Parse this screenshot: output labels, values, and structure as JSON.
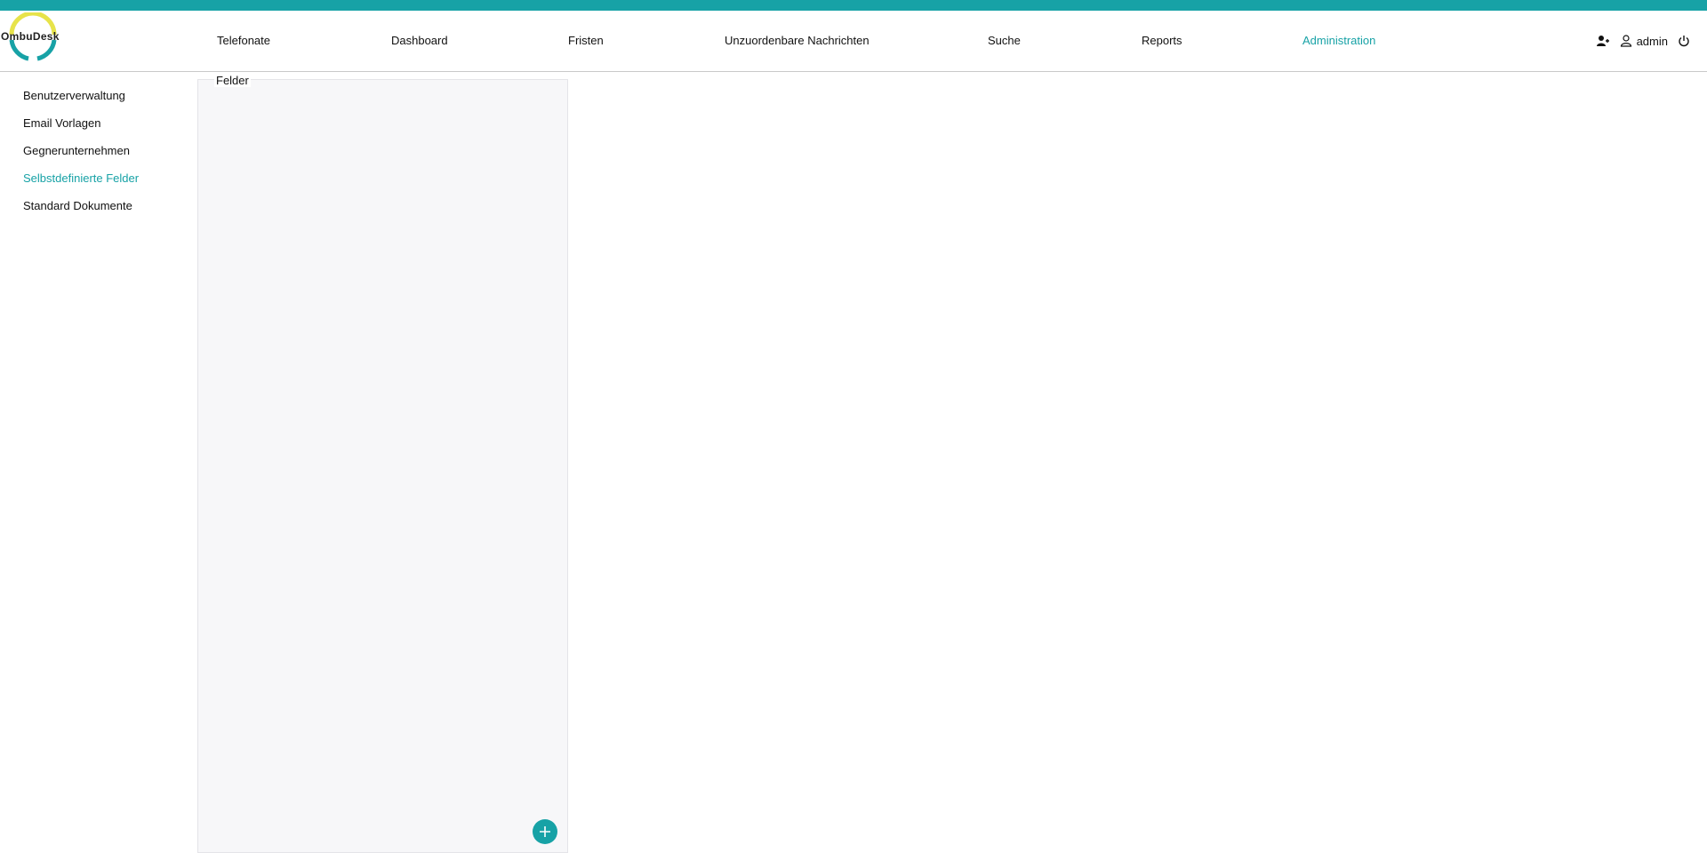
{
  "app": {
    "logo_text": "OmbuDesk",
    "accent_color": "#17a2a6"
  },
  "nav": {
    "items": [
      {
        "label": "Telefonate"
      },
      {
        "label": "Dashboard"
      },
      {
        "label": "Fristen"
      },
      {
        "label": "Unzuordenbare Nachrichten"
      },
      {
        "label": "Suche"
      },
      {
        "label": "Reports"
      },
      {
        "label": "Administration",
        "active": true
      }
    ]
  },
  "user": {
    "name": "admin",
    "icons": [
      "add-user-icon",
      "user-icon",
      "power-icon"
    ]
  },
  "sidebar": {
    "items": [
      {
        "label": "Benutzerverwaltung"
      },
      {
        "label": "Email Vorlagen"
      },
      {
        "label": "Gegnerunternehmen"
      },
      {
        "label": "Selbstdefinierte Felder",
        "active": true
      },
      {
        "label": "Standard Dokumente"
      }
    ]
  },
  "panel": {
    "title": "Felder",
    "add_button_icon": "plus-icon"
  }
}
